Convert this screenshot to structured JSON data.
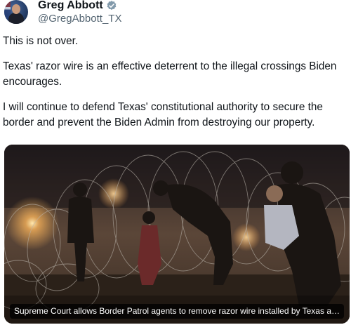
{
  "tweet": {
    "author": {
      "display_name": "Greg Abbott",
      "handle": "@GregAbbott_TX",
      "verified_icon": "verified-badge-icon",
      "verified_color": "#829aab"
    },
    "text": {
      "p1": "This is not over.",
      "p2": "Texas' razor wire is an effective deterrent to the illegal crossings Biden encourages.",
      "p3": "I will continue to defend Texas' constitutional authority to secure the border and prevent the Biden Admin from destroying our property."
    },
    "media": {
      "caption": "Supreme Court allows Border Patrol agents to remove razor wire installed by Texas at M..."
    }
  }
}
